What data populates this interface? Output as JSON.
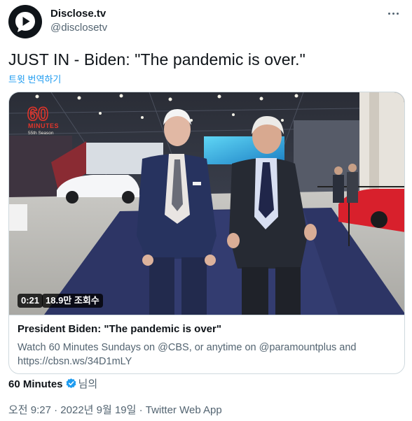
{
  "author": {
    "display_name": "Disclose.tv",
    "handle": "@disclosetv",
    "avatar_icon": "play-bubble-logo"
  },
  "tweet": {
    "text": "JUST IN - Biden: \"The pandemic is over.\"",
    "translate_label": "트윗 번역하기"
  },
  "video": {
    "duration": "0:21",
    "views": "18.9만 조회수",
    "watermark_number": "60",
    "watermark_word": "MINUTES",
    "watermark_season": "55th Season"
  },
  "card": {
    "title": "President Biden: \"The pandemic is over\"",
    "description": "Watch 60 Minutes Sundays on @CBS, or anytime on @paramountplus and https://cbsn.ws/34D1mLY"
  },
  "source": {
    "name": "60 Minutes",
    "suffix": "님의",
    "verified_icon": "verified-badge-icon"
  },
  "meta": {
    "timestamp": "오전 9:27 · 2022년 9월 19일 · Twitter Web App"
  },
  "colors": {
    "link": "#1d9bf0",
    "text": "#0f1419",
    "secondary": "#536471",
    "border": "#cfd9de",
    "watermark": "#e0352b"
  }
}
